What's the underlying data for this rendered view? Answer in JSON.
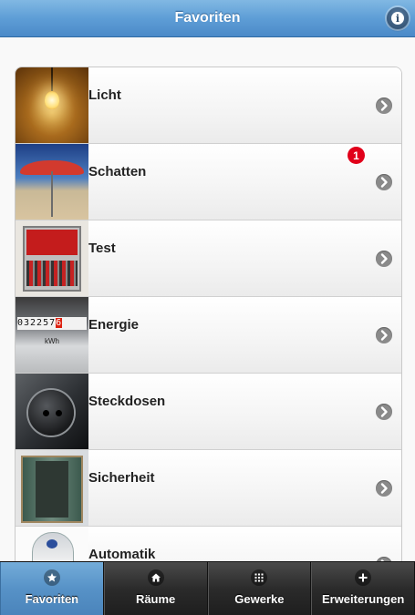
{
  "header": {
    "title": "Favoriten",
    "info_icon": "info-icon",
    "info_glyph": "i"
  },
  "rows": [
    {
      "label": "Licht",
      "icon": "chevron-right-icon"
    },
    {
      "label": "Schatten",
      "badge": "1",
      "icon": "chevron-right-icon"
    },
    {
      "label": "Test",
      "icon": "chevron-right-icon"
    },
    {
      "label": "Energie",
      "icon": "chevron-right-icon",
      "thumb_digits": "032257",
      "thumb_digits_red": "6",
      "thumb_unit": "kWh"
    },
    {
      "label": "Steckdosen",
      "icon": "chevron-right-icon"
    },
    {
      "label": "Sicherheit",
      "icon": "chevron-right-icon"
    },
    {
      "label": "Automatik",
      "icon": "chevron-right-icon"
    }
  ],
  "tabbar": {
    "tabs": [
      {
        "label": "Favoriten",
        "icon": "star-icon",
        "active": true
      },
      {
        "label": "Räume",
        "icon": "home-icon",
        "active": false
      },
      {
        "label": "Gewerke",
        "icon": "grid-icon",
        "active": false
      },
      {
        "label": "Erweiterungen",
        "icon": "plus-icon",
        "active": false
      }
    ]
  },
  "colors": {
    "header_blue": "#5e9ed6",
    "active_tab": "#5792c7",
    "badge_red": "#e1001a"
  }
}
